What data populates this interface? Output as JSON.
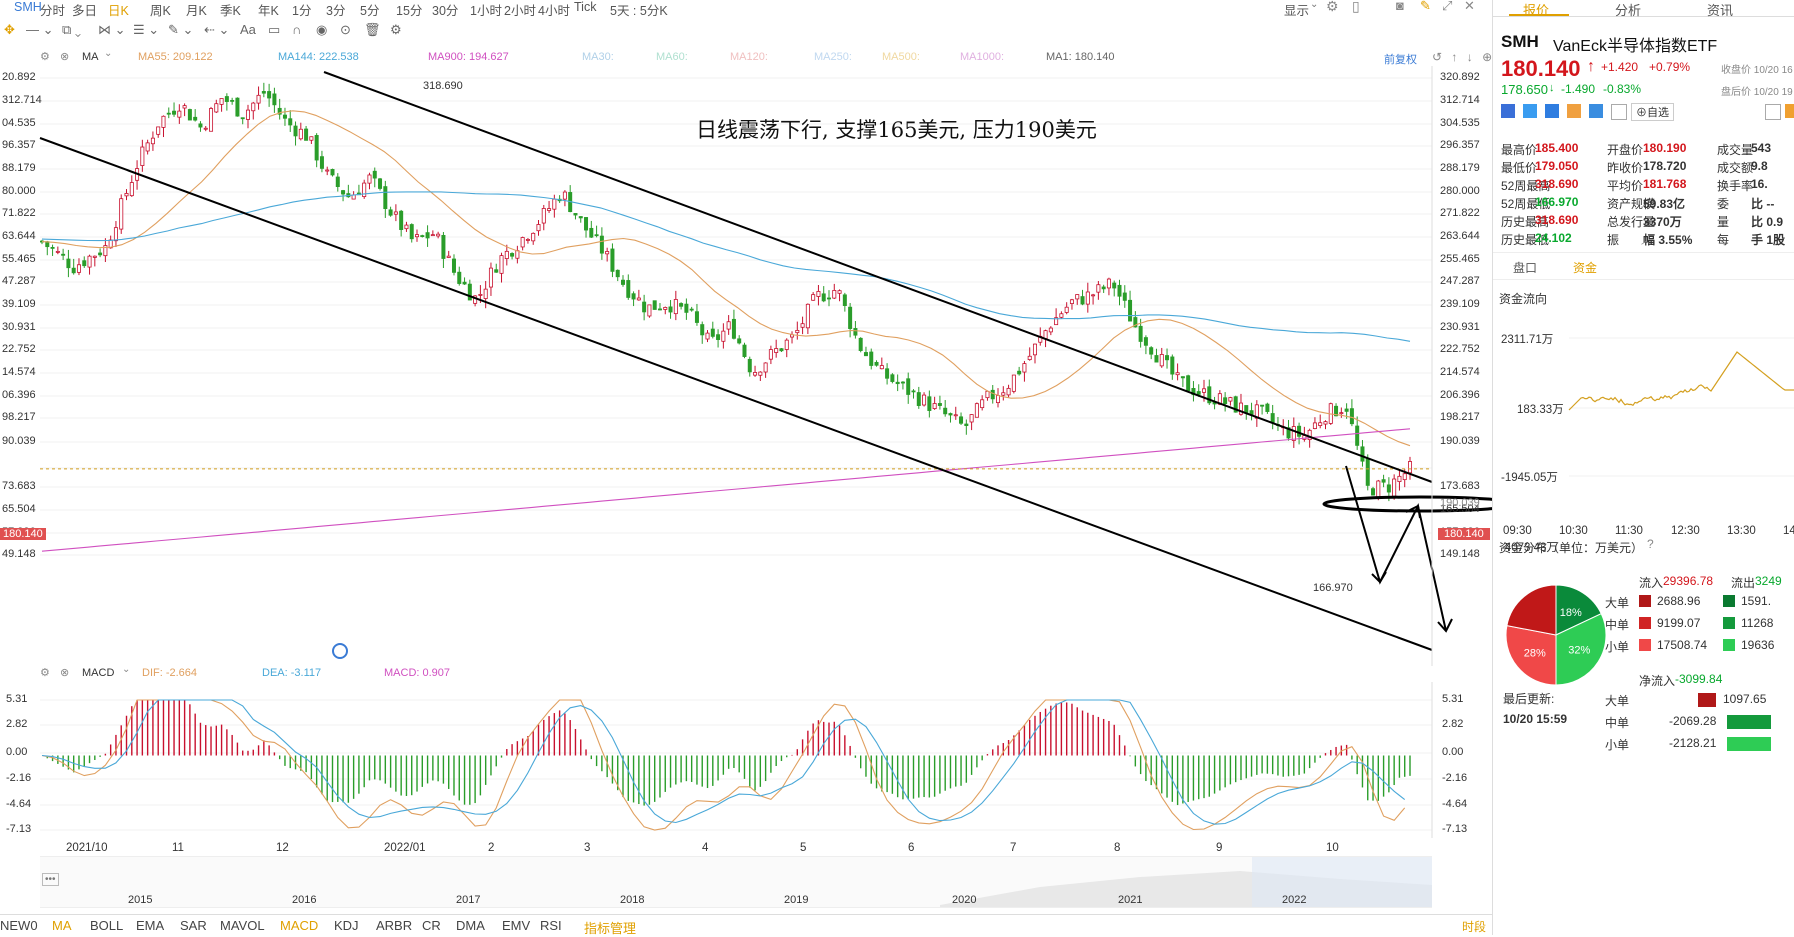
{
  "symbol": "SMH",
  "periods": [
    "分时",
    "多日",
    "日K",
    "周K",
    "月K",
    "季K",
    "年K",
    "1分",
    "3分",
    "5分",
    "15分",
    "30分",
    "1小时",
    "2小时",
    "4小时",
    "Tick",
    "5天 : 5分K"
  ],
  "active_period": "日K",
  "top_right": {
    "display": "显示"
  },
  "ma_bar": {
    "label": "MA",
    "items": [
      {
        "text": "MA55: 209.122",
        "color": "#e0a060"
      },
      {
        "text": "MA144: 222.538",
        "color": "#4aa8d8"
      },
      {
        "text": "MA900: 194.627",
        "color": "#d050c0"
      },
      {
        "text": "MA30:",
        "color": "#b0d0e8"
      },
      {
        "text": "MA60:",
        "color": "#b0e0d0"
      },
      {
        "text": "MA120:",
        "color": "#f0c0c0"
      },
      {
        "text": "MA250:",
        "color": "#c0d8f0"
      },
      {
        "text": "MA500:",
        "color": "#f0d8a0"
      },
      {
        "text": "MA1000:",
        "color": "#e0b0e0"
      },
      {
        "text": "MA1: 180.140",
        "color": "#666666"
      }
    ],
    "fq": "前复权"
  },
  "price_axis": [
    "320.892",
    "312.714",
    "304.535",
    "296.357",
    "288.179",
    "280.000",
    "271.822",
    "263.644",
    "255.465",
    "247.287",
    "239.109",
    "230.931",
    "222.752",
    "214.574",
    "206.396",
    "198.217",
    "190.039",
    "180.140",
    "173.683",
    "165.504",
    "157.326",
    "149.148"
  ],
  "price_axis_left": [
    "20.892",
    "312.714",
    "04.535",
    "96.357",
    "88.179",
    "80.000",
    "71.822",
    "63.644",
    "55.465",
    "47.287",
    "39.109",
    "30.931",
    "22.752",
    "14.574",
    "06.396",
    "98.217",
    "90.039",
    "80.140",
    "73.683",
    "65.504",
    "57.326",
    "49.148"
  ],
  "annotation": "日线震荡下行, 支撑165美元, 压力190美元",
  "high_label": "318.690",
  "low_label": "166.970",
  "current_price_tag": "180.140",
  "right_line_tag": "190.039",
  "macd_bar": {
    "label": "MACD",
    "dif": "DIF: -2.664",
    "dea": "DEA: -3.117",
    "macd": "MACD: 0.907"
  },
  "macd_axis": [
    "5.31",
    "2.82",
    "0.00",
    "-2.16",
    "-4.64",
    "-7.13"
  ],
  "macd_axis_left": [
    "5.31",
    "2.82",
    "0.00",
    "-2.16",
    "-4.64",
    "-7.13"
  ],
  "x_labels": [
    "2021/10",
    "11",
    "12",
    "2022/01",
    "2",
    "3",
    "4",
    "5",
    "6",
    "7",
    "8",
    "9",
    "10"
  ],
  "year_labels": [
    "2015",
    "2016",
    "2017",
    "2018",
    "2019",
    "2020",
    "2021",
    "2022"
  ],
  "indicators": [
    "NEW0",
    "MA",
    "BOLL",
    "EMA",
    "SAR",
    "MAVOL",
    "MACD",
    "KDJ",
    "ARBR",
    "CR",
    "DMA",
    "EMV",
    "RSI",
    "指标管理"
  ],
  "bottom_right": "时段",
  "panel": {
    "tabs": [
      "报价",
      "分析",
      "资讯"
    ],
    "symbol": "SMH",
    "name": "VanEck半导体指数ETF",
    "price": "180.140",
    "change": "+1.420",
    "change_pct": "+0.79%",
    "close_note": "收盘价 10/20 16",
    "after_price": "178.650",
    "after_change": "-1.490",
    "after_pct": "-0.83%",
    "after_note": "盘后价 10/20 19",
    "fav": "自选",
    "stats": [
      [
        "最高价",
        "185.400",
        "开盘价",
        "180.190",
        "成交量",
        "543"
      ],
      [
        "最低价",
        "179.050",
        "昨收价",
        "178.720",
        "成交额",
        "9.8"
      ],
      [
        "52周最高",
        "318.690",
        "平均价",
        "181.768",
        "换手率",
        "16."
      ],
      [
        "52周最低",
        "166.970",
        "资产规模",
        "59.83亿",
        "委",
        "比 --"
      ],
      [
        "历史最高",
        "318.690",
        "总发行量",
        "3370万",
        "量",
        "比 0.9"
      ],
      [
        "历史最低",
        "24.102",
        "振",
        "幅 3.55%",
        "每",
        "手 1股"
      ]
    ],
    "subtabs": [
      "盘口",
      "资金"
    ],
    "flow_title": "资金流向",
    "flow_axis": [
      "2311.71万",
      "183.33万",
      "-1945.05万",
      "-4073.43万"
    ],
    "flow_times": [
      "09:30",
      "10:30",
      "11:30",
      "12:30",
      "13:30",
      "14:30"
    ],
    "dist_title": "资金分布（单位：万美元）",
    "in_label": "流入",
    "in_value": "29396.78",
    "out_label": "流出",
    "out_value": "3249",
    "pie": [
      {
        "label": "18%",
        "value": 18,
        "color": "#0a8a3a"
      },
      {
        "label": "32%",
        "value": 32,
        "color": "#2ecc55"
      },
      {
        "label": "28%",
        "value": 28,
        "color": "#f04848"
      },
      {
        "label": "",
        "value": 22,
        "color": "#c01818"
      }
    ],
    "rows": [
      {
        "name": "大单",
        "in": "2688.96",
        "out": "1591."
      },
      {
        "name": "中单",
        "in": "9199.07",
        "out": "11268"
      },
      {
        "name": "小单",
        "in": "17508.74",
        "out": "19636"
      }
    ],
    "net_label": "净流入",
    "net_value": "-3099.84",
    "updated_label": "最后更新:",
    "updated_time": "10/20 15:59",
    "net_rows": [
      {
        "name": "大单",
        "value": "1097.65",
        "sign": 1
      },
      {
        "name": "中单",
        "value": "-2069.28",
        "sign": -1
      },
      {
        "name": "小单",
        "value": "-2128.21",
        "sign": -1
      }
    ]
  },
  "chart_data": {
    "type": "candlestick",
    "title": "",
    "ylim": [
      149.148,
      320.892
    ],
    "high": 318.69,
    "low": 166.97,
    "last": 180.14,
    "x_categories": [
      "2021/10",
      "11",
      "12",
      "2022/01",
      "2",
      "3",
      "4",
      "5",
      "6",
      "7",
      "8",
      "9",
      "10"
    ],
    "close_path": [
      [
        0,
        262
      ],
      [
        3,
        253
      ],
      [
        6,
        260
      ],
      [
        9,
        290
      ],
      [
        11,
        305
      ],
      [
        13,
        312
      ],
      [
        15,
        303
      ],
      [
        17,
        314
      ],
      [
        19,
        308
      ],
      [
        21,
        316
      ],
      [
        23,
        305
      ],
      [
        25,
        300
      ],
      [
        27,
        285
      ],
      [
        29,
        278
      ],
      [
        31,
        285
      ],
      [
        33,
        272
      ],
      [
        35,
        262
      ],
      [
        37,
        265
      ],
      [
        39,
        250
      ],
      [
        41,
        241
      ],
      [
        43,
        255
      ],
      [
        45,
        262
      ],
      [
        47,
        270
      ],
      [
        49,
        280
      ],
      [
        51,
        268
      ],
      [
        53,
        258
      ],
      [
        55,
        246
      ],
      [
        57,
        238
      ],
      [
        59,
        240
      ],
      [
        61,
        236
      ],
      [
        63,
        225
      ],
      [
        65,
        232
      ],
      [
        67,
        215
      ],
      [
        69,
        222
      ],
      [
        71,
        228
      ],
      [
        73,
        242
      ],
      [
        75,
        245
      ],
      [
        77,
        225
      ],
      [
        79,
        215
      ],
      [
        81,
        210
      ],
      [
        83,
        205
      ],
      [
        85,
        200
      ],
      [
        87,
        195
      ],
      [
        89,
        205
      ],
      [
        91,
        210
      ],
      [
        93,
        220
      ],
      [
        95,
        232
      ],
      [
        97,
        240
      ],
      [
        99,
        243
      ],
      [
        101,
        247
      ],
      [
        103,
        232
      ],
      [
        105,
        222
      ],
      [
        107,
        212
      ],
      [
        109,
        208
      ],
      [
        111,
        205
      ],
      [
        113,
        202
      ],
      [
        115,
        200
      ],
      [
        117,
        194
      ],
      [
        119,
        192
      ],
      [
        121,
        200
      ],
      [
        123,
        203
      ],
      [
        125,
        173
      ],
      [
        127,
        174
      ],
      [
        129,
        180
      ]
    ],
    "lines": [
      {
        "name": "MA55",
        "value": 209.122
      },
      {
        "name": "MA144",
        "value": 222.538
      },
      {
        "name": "MA900",
        "value": 194.627
      },
      {
        "name": "MA1",
        "value": 180.14
      }
    ],
    "macd": {
      "dif": -2.664,
      "dea": -3.117,
      "macd": 0.907,
      "ylim": [
        -7.13,
        5.31
      ]
    }
  }
}
